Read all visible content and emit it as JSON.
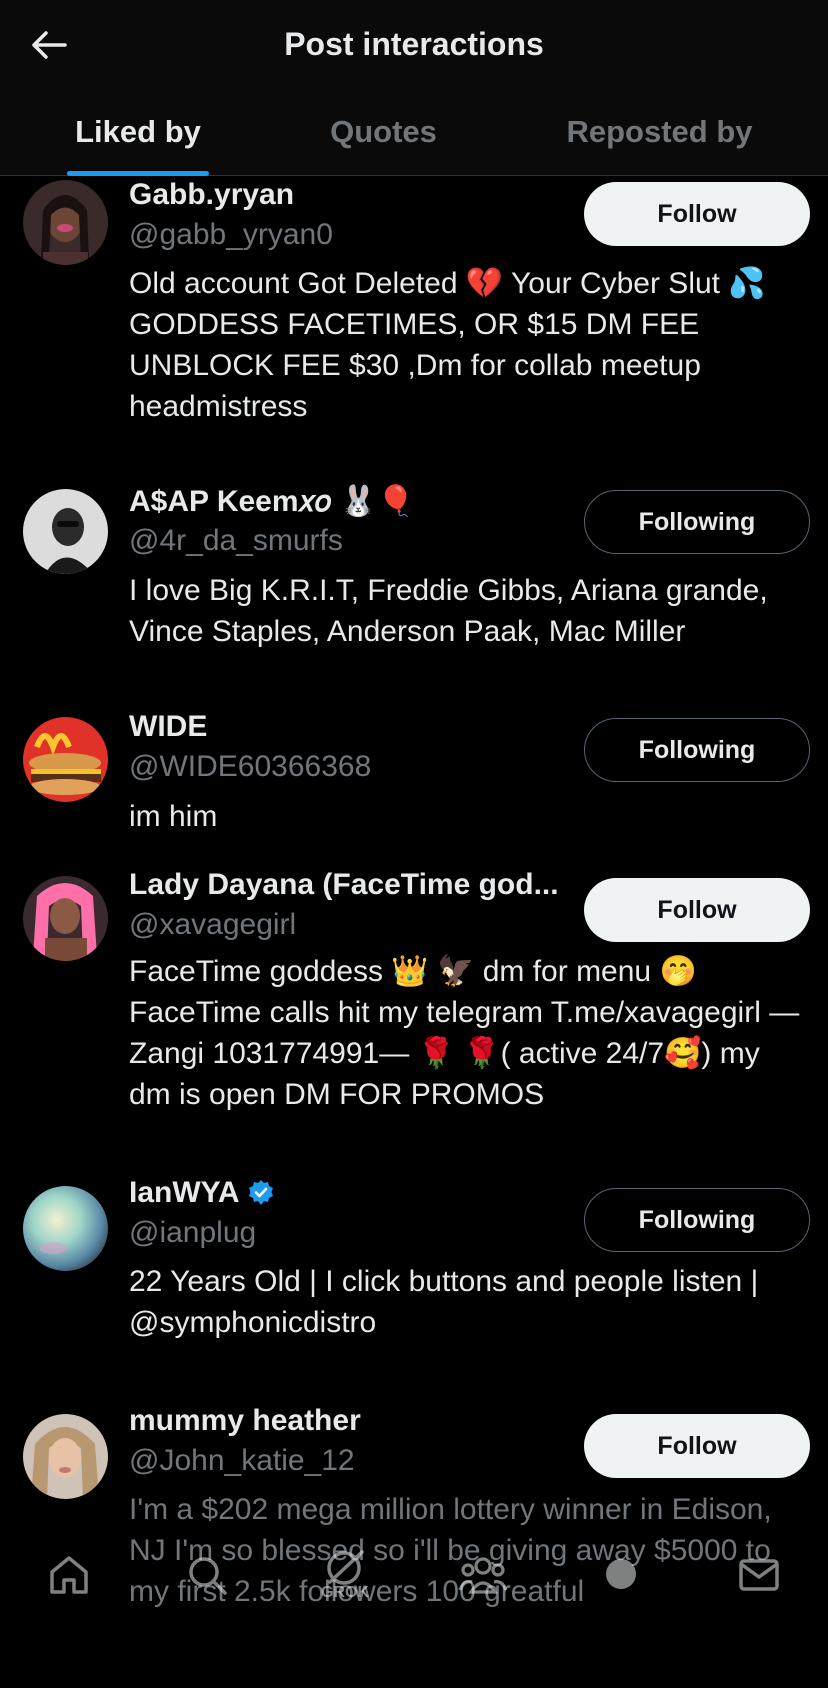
{
  "header": {
    "title": "Post interactions"
  },
  "tabs": [
    {
      "label": "Liked by"
    },
    {
      "label": "Quotes"
    },
    {
      "label": "Reposted by"
    }
  ],
  "users": [
    {
      "name": "Gabb.yryan",
      "handle": "@gabb_yryan0",
      "bio": "Old account Got Deleted 💔 Your Cyber Slut 💦 GODDESS FACETIMES, OR $15 DM FEE UNBLOCK FEE $30 ,Dm for collab meetup headmistress",
      "button": "Follow"
    },
    {
      "name": "A$AP Keem𝑥𝑜 🐰🎈",
      "handle": "@4r_da_smurfs",
      "bio": "I love Big K.R.I.T, Freddie Gibbs, Ariana grande, Vince Staples, Anderson Paak, Mac Miller",
      "button": "Following"
    },
    {
      "name": "WIDE",
      "handle": "@WIDE60366368",
      "bio": "im him",
      "button": "Following"
    },
    {
      "name": "Lady Dayana (FaceTime god...",
      "handle": "@xavagegirl",
      "bio": "FaceTime goddess 👑 🦅 dm for menu 🤭 FaceTime calls hit my telegram T.me/xavagegirl —Zangi 1031774991— 🌹 🌹( active 24/7🥰) my dm is open DM FOR PROMOS",
      "button": "Follow"
    },
    {
      "name": "IanWYA",
      "handle": "@ianplug",
      "bio": "22 Years Old | I click buttons and people listen | @symphonicdistro",
      "button": "Following"
    },
    {
      "name": "mummy heather",
      "handle": "@John_katie_12",
      "bio": "I'm a $202 mega million lottery winner in Edison, NJ I'm so blessed so i'll be giving away $5000 to my first 2.5k followers 100 greatful",
      "button": "Follow"
    }
  ],
  "bottom_nav": {
    "grok_label": "GROK"
  }
}
